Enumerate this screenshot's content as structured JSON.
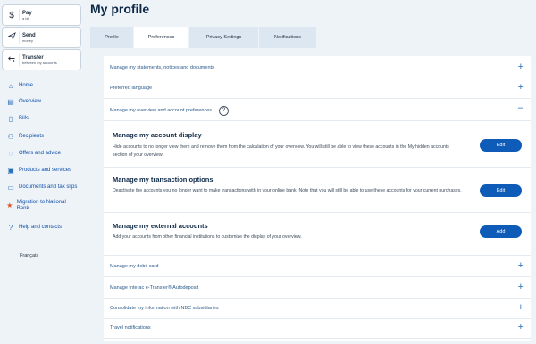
{
  "sidebar": {
    "actions": [
      {
        "title": "Pay",
        "subtitle": "a bill",
        "icon": "dollar-icon"
      },
      {
        "title": "Send",
        "subtitle": "money",
        "icon": "paper-plane-icon"
      },
      {
        "title": "Transfer",
        "subtitle": "between my accounts",
        "icon": "transfer-arrows-icon"
      }
    ],
    "nav": [
      {
        "label": "Home",
        "icon": "home-icon"
      },
      {
        "label": "Overview",
        "icon": "overview-icon"
      },
      {
        "label": "Bills",
        "icon": "bill-icon"
      },
      {
        "label": "Recipients",
        "icon": "recipients-icon"
      },
      {
        "label": "Offers and advice",
        "icon": "offers-icon"
      },
      {
        "label": "Products and services",
        "icon": "products-icon"
      },
      {
        "label": "Documents and tax slips",
        "icon": "folder-icon"
      },
      {
        "label": "Migration to National Bank",
        "icon": "migration-icon"
      },
      {
        "label": "Help and contacts",
        "icon": "help-icon"
      }
    ],
    "language": "Français"
  },
  "page": {
    "title": "My profile"
  },
  "tabs": [
    "Profile",
    "Preferences",
    "Privacy Settings",
    "Notifications"
  ],
  "active_tab": "Preferences",
  "sections": {
    "statements": "Manage my statements, notices and documents",
    "language": "Preferred language",
    "overview": "Manage my overview and account preferences",
    "debit": "Manage my debit card",
    "interac": "Manage Interac e-Transfer® Autodeposit",
    "consolidate": "Consolidate my information with NBC subsidiaries",
    "travel": "Travel notifications"
  },
  "subsections": {
    "display": {
      "title": "Manage my account display",
      "desc": "Hide accounts to no longer view them and remove them from the calculation of your overview. You will still be able to view these accounts in the My hidden accounts section of your overview.",
      "button": "Edit"
    },
    "transaction": {
      "title": "Manage my transaction options",
      "desc": "Deactivate the accounts you no longer want to make transactions with in your online bank. Note that you will still be able to use these accounts for your current purchases.",
      "button": "Edit"
    },
    "external": {
      "title": "Manage my external accounts",
      "desc": "Add your accounts from other financial institutions to customize the display of your overview.",
      "button": "Add"
    }
  },
  "colors": {
    "accent": "#0f5bb8",
    "link": "#2a5a8c",
    "nav": "#0f4fa8"
  }
}
